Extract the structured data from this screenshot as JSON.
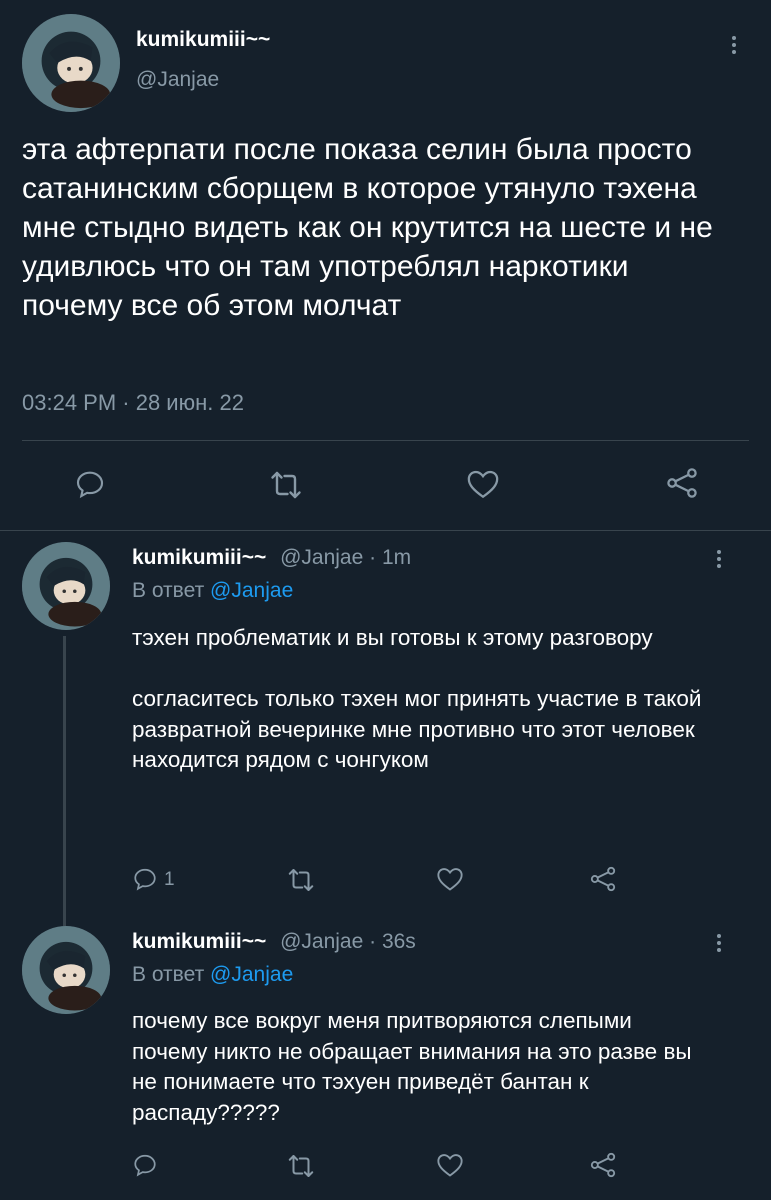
{
  "main_tweet": {
    "display_name": "kumikumiii~~",
    "handle": "@Janjae",
    "text": "эта афтерпати после показа селин была просто сатанинским сборщем в которое утянуло тэхена мне стыдно видеть как он крутится на шесте и не удивлюсь что он там употреблял наркотики почему все об этом молчат",
    "timestamp": "03:24 PM · 28 июн. 22",
    "actions": [
      "reply-icon",
      "retweet-icon",
      "like-icon",
      "share-icon"
    ]
  },
  "replies": [
    {
      "display_name": "kumikumiii~~",
      "handle": "@Janjae",
      "time": "· 1m",
      "reply_prefix": "В ответ",
      "reply_to": "@Janjae",
      "text": "тэхен проблематик и вы готовы к этому разговору\n\nсогласитесь только тэхен мог принять участие в такой развратной вечеринке мне противно что этот человек находится рядом с чонгуком",
      "reply_count": "1"
    },
    {
      "display_name": "kumikumiii~~",
      "handle": "@Janjae",
      "time": "· 36s",
      "reply_prefix": "В ответ",
      "reply_to": "@Janjae",
      "text": "почему все вокруг меня притворяются слепыми почему никто не обращает внимания на это разве вы не понимаете что тэхуен приведёт бантан к распаду?????",
      "reply_count": ""
    }
  ],
  "colors": {
    "background": "#15202b",
    "text": "#ffffff",
    "muted": "#8899a6",
    "link": "#1d9bf0",
    "divider": "#38444d"
  }
}
